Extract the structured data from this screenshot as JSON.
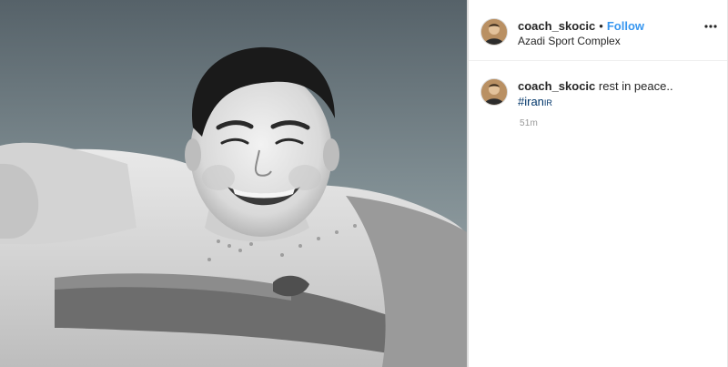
{
  "post": {
    "photo_icon": "profile-photo",
    "username": "coach_skocic",
    "separator": "•",
    "follow_label": "Follow",
    "location": "Azadi Sport Complex",
    "more_icon": "more-options-icon"
  },
  "caption": {
    "username": "coach_skocic",
    "text": "rest in peace..",
    "hashtag": "#iran",
    "hashtag_flag": "IR",
    "time": "51m"
  },
  "colors": {
    "link": "#3897f0",
    "hashtag": "#003569",
    "text": "#262626",
    "muted": "#999999"
  }
}
